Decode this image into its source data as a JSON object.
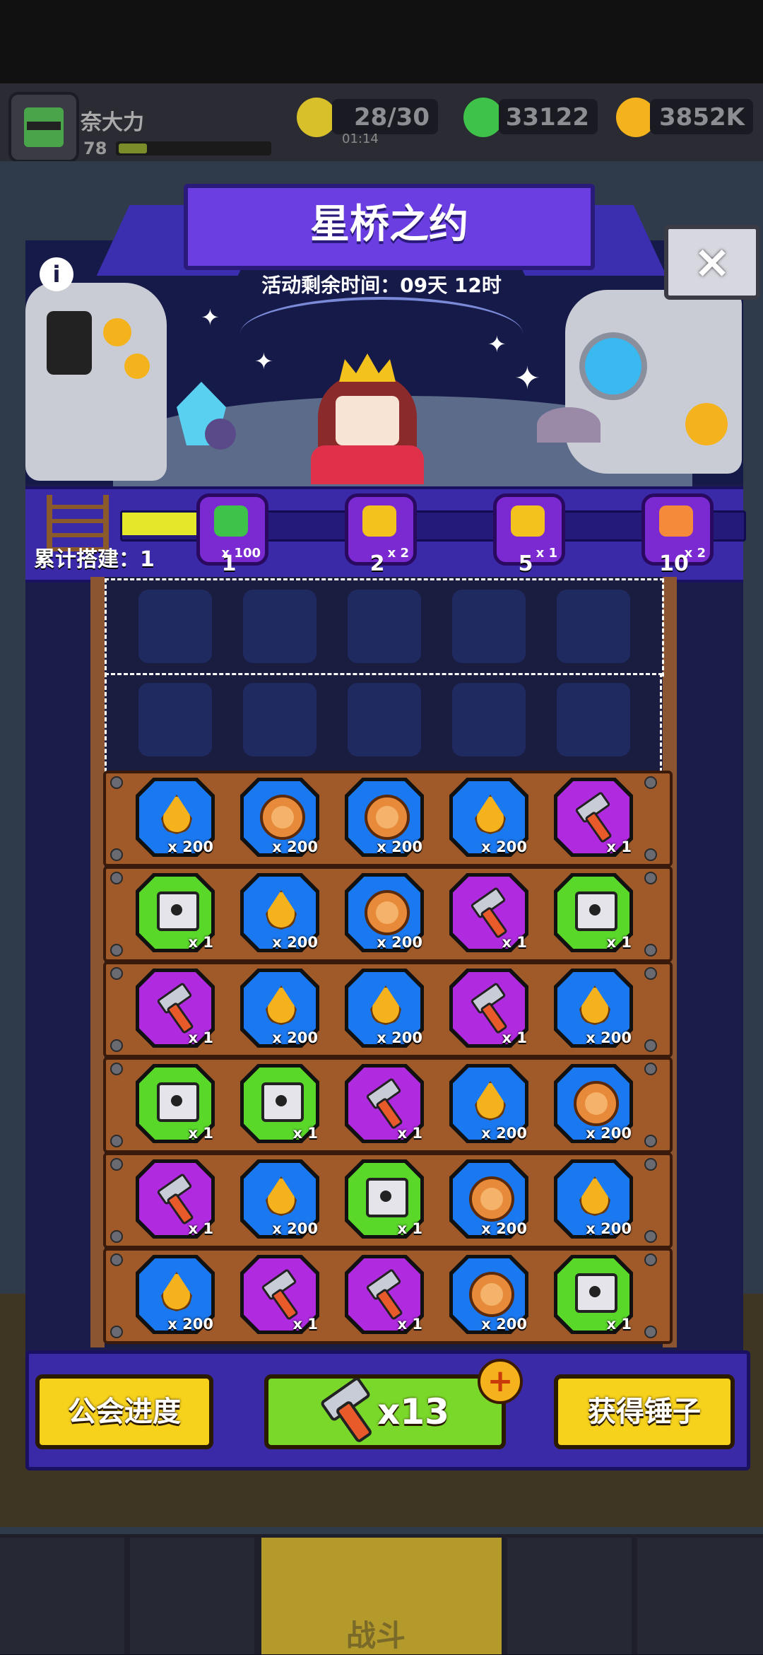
{
  "player": {
    "name": "奈大力",
    "level": "78",
    "xp_progress": 0.12
  },
  "resources": [
    {
      "name": "energy",
      "value": "28/30",
      "timer": "01:14",
      "color": "#d8c02a"
    },
    {
      "name": "gems",
      "value": "33122",
      "color": "#3ec24a"
    },
    {
      "name": "gold",
      "value": "3852K",
      "color": "#f4b21c"
    }
  ],
  "event": {
    "title": "星桥之约",
    "countdown": "活动剩余时间：09天 12时",
    "info_icon": "i",
    "close_icon": "×"
  },
  "progress": {
    "label": "累计搭建：1",
    "fill_fraction": 0.12,
    "milestones": [
      {
        "icon": "green-gem-icon",
        "qty": "x 100",
        "level": "1",
        "color": "#3ec24a"
      },
      {
        "icon": "gold-ticket-icon",
        "qty": "x 2",
        "level": "2",
        "color": "#f4c21c"
      },
      {
        "icon": "key-icon",
        "qty": "x 1",
        "level": "5",
        "color": "#f4c21c"
      },
      {
        "icon": "puzzle-piece-icon",
        "qty": "x 2",
        "level": "10",
        "color": "#f48a3a"
      }
    ]
  },
  "board": {
    "rows": [
      [
        {
          "type": "drop",
          "color": "blue",
          "qty": "x 200"
        },
        {
          "type": "coin",
          "color": "blue",
          "qty": "x 200"
        },
        {
          "type": "coin",
          "color": "blue",
          "qty": "x 200"
        },
        {
          "type": "drop",
          "color": "blue",
          "qty": "x 200"
        },
        {
          "type": "hammer",
          "color": "purple",
          "qty": "x 1"
        }
      ],
      [
        {
          "type": "chest",
          "color": "green",
          "qty": "x 1"
        },
        {
          "type": "drop",
          "color": "blue",
          "qty": "x 200"
        },
        {
          "type": "coin",
          "color": "blue",
          "qty": "x 200"
        },
        {
          "type": "hammer",
          "color": "purple",
          "qty": "x 1"
        },
        {
          "type": "chest",
          "color": "green",
          "qty": "x 1"
        }
      ],
      [
        {
          "type": "hammer",
          "color": "purple",
          "qty": "x 1"
        },
        {
          "type": "drop",
          "color": "blue",
          "qty": "x 200"
        },
        {
          "type": "drop",
          "color": "blue",
          "qty": "x 200"
        },
        {
          "type": "hammer",
          "color": "purple",
          "qty": "x 1"
        },
        {
          "type": "drop",
          "color": "blue",
          "qty": "x 200"
        }
      ],
      [
        {
          "type": "chest",
          "color": "green",
          "qty": "x 1"
        },
        {
          "type": "chest",
          "color": "green",
          "qty": "x 1"
        },
        {
          "type": "hammer",
          "color": "purple",
          "qty": "x 1"
        },
        {
          "type": "drop",
          "color": "blue",
          "qty": "x 200"
        },
        {
          "type": "coin",
          "color": "blue",
          "qty": "x 200"
        }
      ],
      [
        {
          "type": "hammer",
          "color": "purple",
          "qty": "x 1"
        },
        {
          "type": "drop",
          "color": "blue",
          "qty": "x 200"
        },
        {
          "type": "chest",
          "color": "green",
          "qty": "x 1"
        },
        {
          "type": "coin",
          "color": "blue",
          "qty": "x 200"
        },
        {
          "type": "drop",
          "color": "blue",
          "qty": "x 200"
        }
      ],
      [
        {
          "type": "drop",
          "color": "blue",
          "qty": "x 200"
        },
        {
          "type": "hammer",
          "color": "purple",
          "qty": "x 1"
        },
        {
          "type": "hammer",
          "color": "purple",
          "qty": "x 1"
        },
        {
          "type": "coin",
          "color": "blue",
          "qty": "x 200"
        },
        {
          "type": "chest",
          "color": "green",
          "qty": "x 1"
        }
      ]
    ]
  },
  "actions": {
    "guild_progress": "公会进度",
    "hammer_count": "x13",
    "plus": "+",
    "get_hammer": "获得锤子"
  },
  "nav": {
    "battle": "战斗"
  }
}
